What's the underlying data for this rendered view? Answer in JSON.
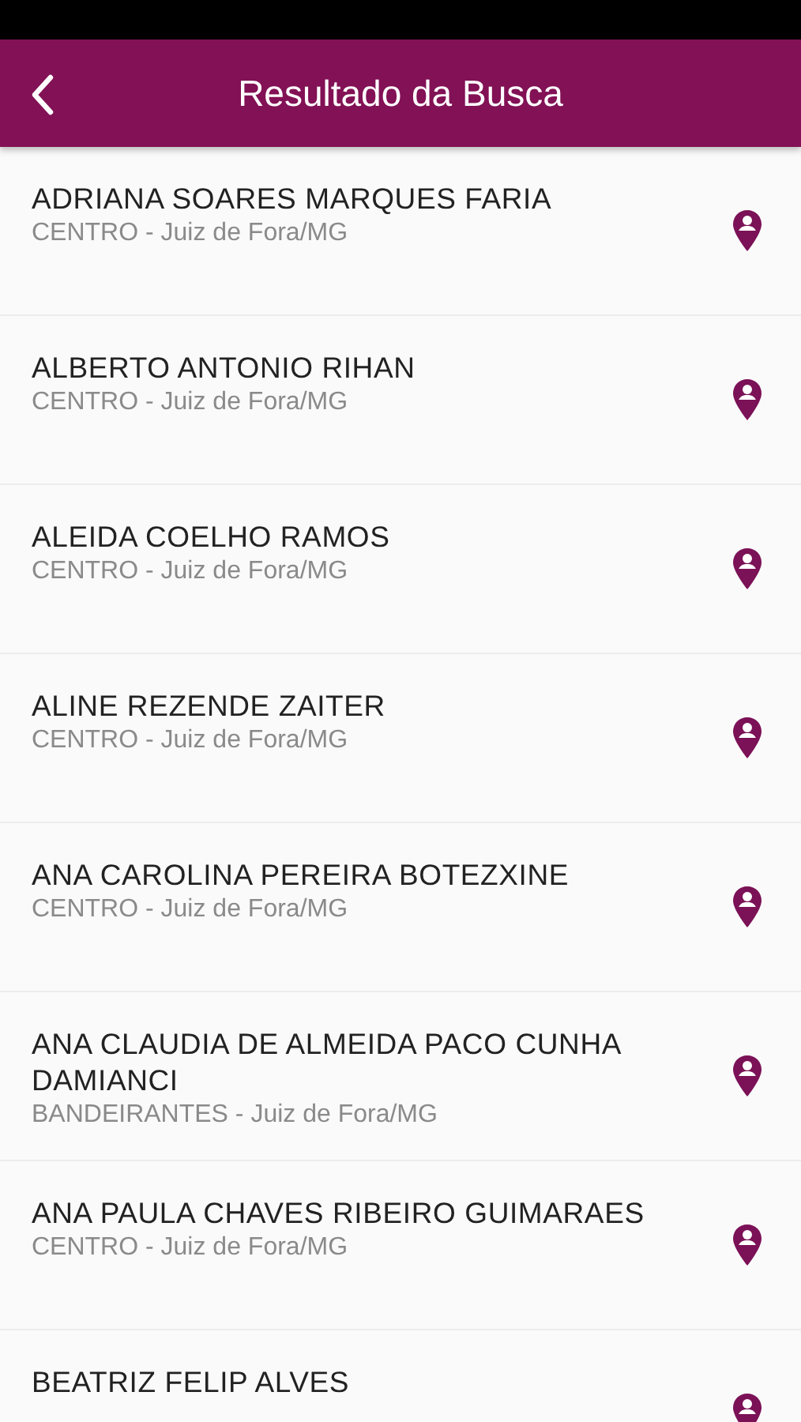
{
  "header": {
    "title": "Resultado da Busca"
  },
  "results": [
    {
      "name": "ADRIANA SOARES MARQUES FARIA",
      "location": "CENTRO - Juiz de Fora/MG"
    },
    {
      "name": "ALBERTO ANTONIO RIHAN",
      "location": "CENTRO - Juiz de Fora/MG"
    },
    {
      "name": "ALEIDA COELHO RAMOS",
      "location": "CENTRO - Juiz de Fora/MG"
    },
    {
      "name": "ALINE REZENDE ZAITER",
      "location": "CENTRO - Juiz de Fora/MG"
    },
    {
      "name": "ANA CAROLINA PEREIRA BOTEZXINE",
      "location": "CENTRO - Juiz de Fora/MG"
    },
    {
      "name": "ANA CLAUDIA DE ALMEIDA PACO CUNHA DAMIANCI",
      "location": "BANDEIRANTES - Juiz de Fora/MG"
    },
    {
      "name": "ANA PAULA CHAVES RIBEIRO GUIMARAES",
      "location": "CENTRO - Juiz de Fora/MG"
    },
    {
      "name": "BEATRIZ FELIP ALVES"
    }
  ]
}
